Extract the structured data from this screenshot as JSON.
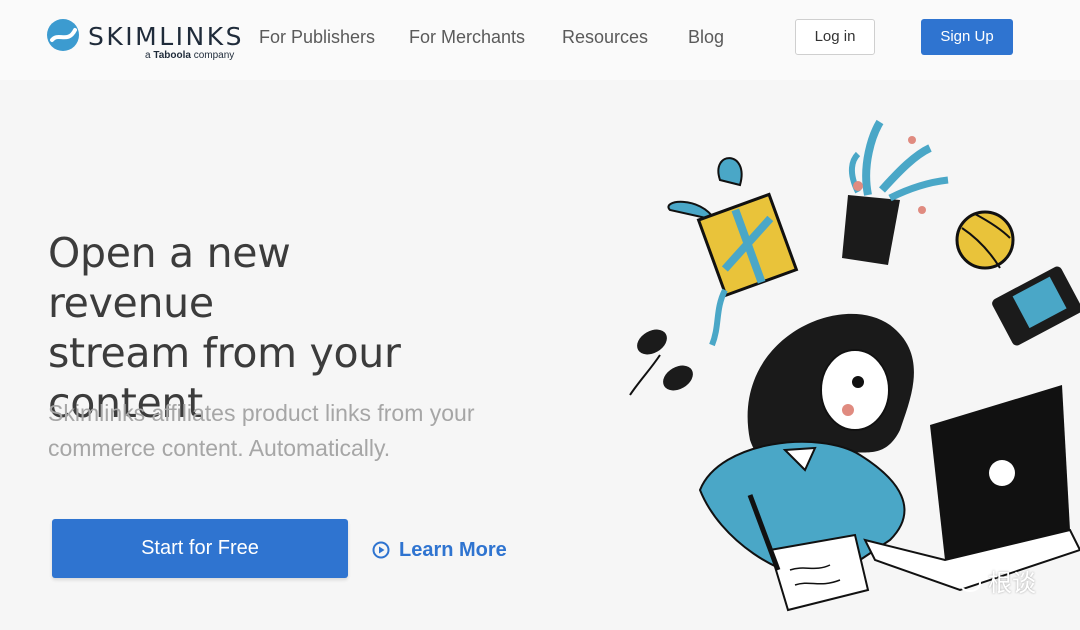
{
  "brand": {
    "name": "SKIMLINKS",
    "tagline_prefix": "a",
    "tagline_brand": "Taboola",
    "tagline_suffix": "company",
    "accent_color": "#2f74d0",
    "logo_color": "#3c9bd0"
  },
  "nav": {
    "items": [
      {
        "label": "For Publishers"
      },
      {
        "label": "For Merchants"
      },
      {
        "label": "Resources"
      },
      {
        "label": "Blog"
      }
    ],
    "login_label": "Log in",
    "signup_label": "Sign Up"
  },
  "hero": {
    "title_lines": [
      "Open a new revenue",
      "stream from your",
      "content"
    ],
    "subtitle_lines": [
      "Skimlinks affiliates product links from your",
      "commerce content. Automatically."
    ],
    "primary_cta": "Start for Free",
    "secondary_cta": "Learn More",
    "secondary_cta_icon": "play-circle-icon"
  },
  "illustration": {
    "description_icons": [
      "gift-icon",
      "plant-icon",
      "ball-icon",
      "phone-icon",
      "sunglasses-icon",
      "laptop-icon",
      "pen-icon",
      "notebook-icon"
    ]
  },
  "watermark": {
    "text": "根谈",
    "icon": "wechat-icon"
  }
}
